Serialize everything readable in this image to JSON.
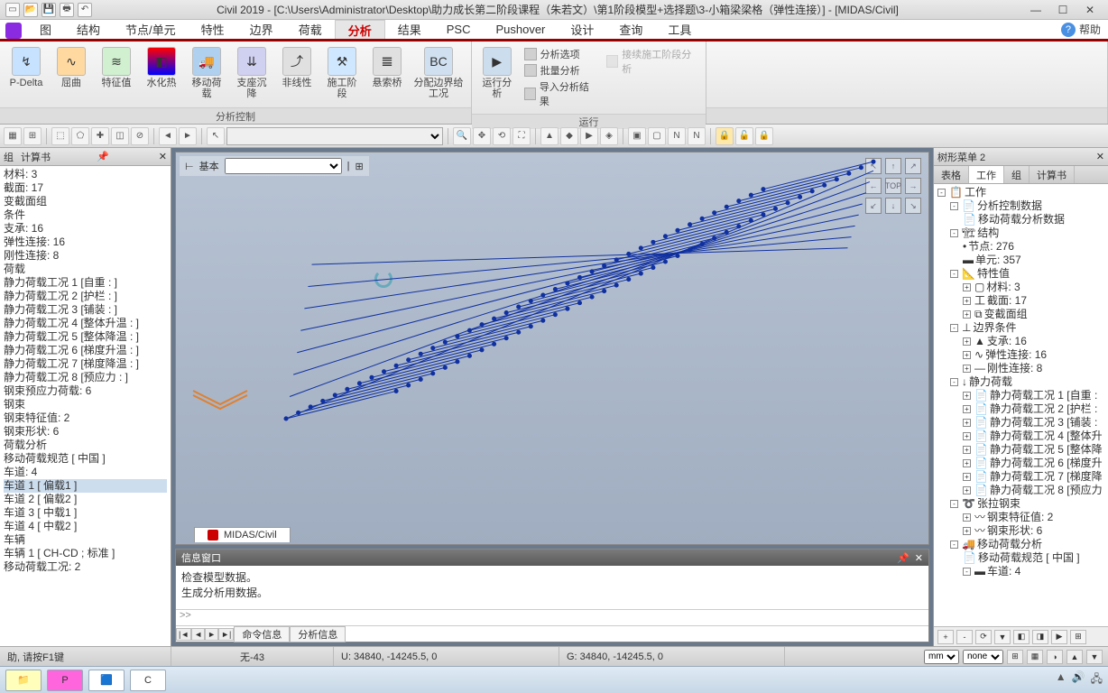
{
  "title": "Civil 2019 - [C:\\Users\\Administrator\\Desktop\\助力成长第二阶段课程（朱若文）\\第1阶段模型+选择题\\3-小箱梁梁格（弹性连接）] - [MIDAS/Civil]",
  "menu": [
    "图",
    "结构",
    "节点/单元",
    "特性",
    "边界",
    "荷载",
    "分析",
    "结果",
    "PSC",
    "Pushover",
    "设计",
    "查询",
    "工具"
  ],
  "menu_active_index": 6,
  "help_label": "帮助",
  "ribbon": {
    "group1": {
      "label": "分析控制",
      "buttons": [
        "P-Delta",
        "屈曲",
        "特征值",
        "水化热",
        "移动荷载",
        "支座沉降",
        "非线性",
        "施工阶段",
        "悬索桥",
        "分配边界给工况"
      ]
    },
    "group2": {
      "label": "运行",
      "big": "运行分析",
      "rows": [
        "分析选项",
        "批量分析",
        "导入分析结果"
      ],
      "disabled": "接续施工阶段分析"
    }
  },
  "left": {
    "tabs": [
      "组",
      "计算书"
    ],
    "items": [
      "材料: 3",
      "截面: 17",
      "变截面组",
      "条件",
      "支承: 16",
      "弹性连接: 16",
      "刚性连接: 8",
      "荷载",
      "静力荷载工况 1 [自重 : ]",
      "静力荷载工况 2 [护栏 : ]",
      "静力荷载工况 3 [铺装 : ]",
      "静力荷载工况 4 [整体升温 : ]",
      "静力荷载工况 5 [整体降温 : ]",
      "静力荷载工况 6 [梯度升温 : ]",
      "静力荷载工况 7 [梯度降温 : ]",
      "静力荷载工况 8 [预应力 : ]",
      "钢束预应力荷载: 6",
      "钢束",
      "钢束特征值: 2",
      "钢束形状: 6",
      "荷载分析",
      "移动荷载规范 [ 中国 ]",
      "车道: 4",
      "车道 1 [ 偏载1 ]",
      "车道 2 [ 偏载2 ]",
      "车道 3 [ 中载1 ]",
      "车道 4 [ 中载2 ]",
      "车辆",
      "车辆 1 [ CH-CD ; 标准 ]",
      "移动荷载工况: 2"
    ]
  },
  "right": {
    "title": "树形菜单 2",
    "tabs": [
      "表格",
      "工作",
      "组",
      "计算书"
    ],
    "active_tab": 1,
    "tree": {
      "root": "工作",
      "n1": "分析控制数据",
      "n1a": "移动荷载分析数据",
      "n2": "结构",
      "n2a": "节点: 276",
      "n2b": "单元: 357",
      "n3": "特性值",
      "n3a": "材料: 3",
      "n3b": "截面: 17",
      "n3c": "变截面组",
      "n4": "边界条件",
      "n4a": "支承: 16",
      "n4b": "弹性连接: 16",
      "n4c": "刚性连接: 8",
      "n5": "静力荷载",
      "n5a": "静力荷载工况 1 [自重 :",
      "n5b": "静力荷载工况 2 [护栏 :",
      "n5c": "静力荷载工况 3 [铺装 :",
      "n5d": "静力荷载工况 4 [整体升",
      "n5e": "静力荷载工况 5 [整体降",
      "n5f": "静力荷载工况 6 [梯度升",
      "n5g": "静力荷载工况 7 [梯度降",
      "n5h": "静力荷载工况 8 [预应力",
      "n6": "张拉钢束",
      "n6a": "钢束特征值: 2",
      "n6b": "钢束形状: 6",
      "n7": "移动荷载分析",
      "n7a": "移动荷载规范 [ 中国 ]",
      "n7b": "车道: 4"
    }
  },
  "viewport": {
    "preset_label": "基本",
    "tab": "MIDAS/Civil",
    "top_label": "TOP"
  },
  "msg": {
    "title": "信息窗口",
    "lines": [
      "检查模型数据。",
      "生成分析用数据。"
    ],
    "prompt": ">>",
    "tabs": [
      "命令信息",
      "分析信息"
    ]
  },
  "status": {
    "hint": "助, 请按F1键",
    "f1": "无-43",
    "f2": "U: 34840, -14245.5, 0",
    "f3": "G: 34840, -14245.5, 0",
    "unit1": "mm",
    "unit2": "none"
  }
}
